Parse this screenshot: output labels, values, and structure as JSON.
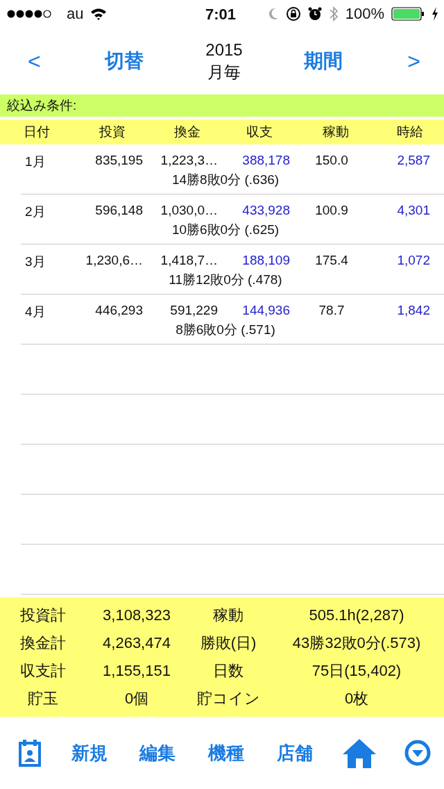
{
  "status_bar": {
    "carrier": "au",
    "time": "7:01",
    "battery": "100%"
  },
  "nav": {
    "prev": "<",
    "switch": "切替",
    "year": "2015",
    "mode": "月毎",
    "period": "期間",
    "next": ">"
  },
  "filter": {
    "label": "絞込み条件:"
  },
  "table": {
    "columns": [
      "日付",
      "投資",
      "換金",
      "収支",
      "稼動",
      "時給"
    ],
    "rows": [
      {
        "date": "1月",
        "invest": "835,195",
        "exchange": "1,223,3…",
        "balance": "388,178",
        "hours": "150.0",
        "hourly": "2,587",
        "record": "14勝8敗0分 (.636)"
      },
      {
        "date": "2月",
        "invest": "596,148",
        "exchange": "1,030,0…",
        "balance": "433,928",
        "hours": "100.9",
        "hourly": "4,301",
        "record": "10勝6敗0分 (.625)"
      },
      {
        "date": "3月",
        "invest": "1,230,6…",
        "exchange": "1,418,7…",
        "balance": "188,109",
        "hours": "175.4",
        "hourly": "1,072",
        "record": "11勝12敗0分 (.478)"
      },
      {
        "date": "4月",
        "invest": "446,293",
        "exchange": "591,229",
        "balance": "144,936",
        "hours": "78.7",
        "hourly": "1,842",
        "record": "8勝6敗0分 (.571)"
      }
    ]
  },
  "summary": [
    {
      "label": "投資計",
      "value": "3,108,323",
      "label2": "稼動",
      "value2": "505.1h(2,287)"
    },
    {
      "label": "換金計",
      "value": "4,263,474",
      "label2": "勝敗(日)",
      "value2": "43勝32敗0分(.573)"
    },
    {
      "label": "収支計",
      "value": "1,155,151",
      "label2": "日数",
      "value2": "75日(15,402)"
    },
    {
      "label": "貯玉",
      "value": "0個",
      "label2": "貯コイン",
      "value2": "0枚"
    }
  ],
  "toolbar": [
    "新規",
    "編集",
    "機種",
    "店舗"
  ]
}
